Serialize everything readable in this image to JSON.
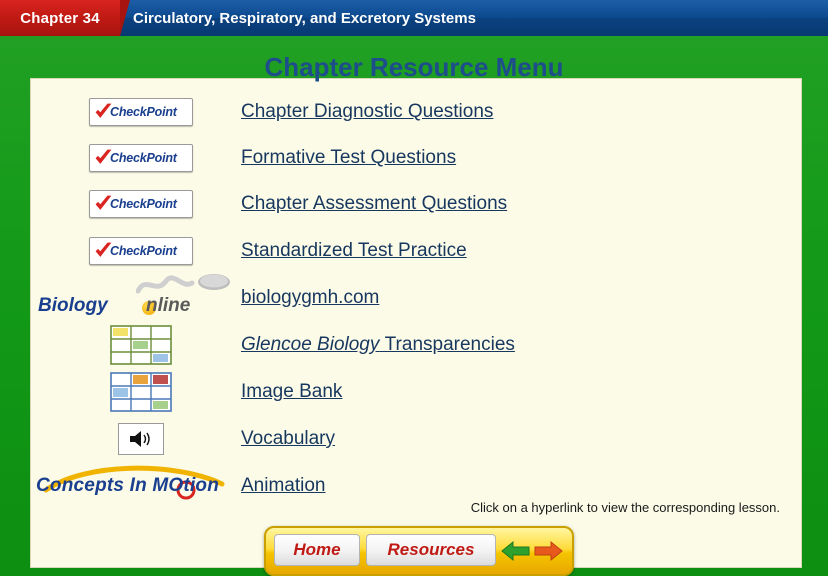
{
  "header": {
    "chapter_label": "Chapter 34",
    "title": "Circulatory, Respiratory, and Excretory Systems"
  },
  "slide": {
    "title": "Chapter Resource Menu",
    "footnote": "Click on a hyperlink to view the corresponding lesson.",
    "rows": [
      {
        "icon": "checkpoint-logo",
        "icon_text": "CheckPoint",
        "link": "Chapter Diagnostic Questions"
      },
      {
        "icon": "checkpoint-logo",
        "icon_text": "CheckPoint",
        "link": "Formative Test Questions"
      },
      {
        "icon": "checkpoint-logo",
        "icon_text": "CheckPoint",
        "link": "Chapter Assessment Questions"
      },
      {
        "icon": "checkpoint-logo",
        "icon_text": "CheckPoint",
        "link": "Standardized Test Practice"
      },
      {
        "icon": "biology-online-logo",
        "icon_text": "Biology Online",
        "link": "biologygmh.com"
      },
      {
        "icon": "transparency-grid-icon",
        "icon_text": "",
        "link": "Glencoe Biology Transparencies",
        "italic_words": "Glencoe Biology"
      },
      {
        "icon": "image-bank-grid-icon",
        "icon_text": "",
        "link": "Image Bank"
      },
      {
        "icon": "speaker-icon",
        "icon_text": "",
        "link": "Vocabulary"
      },
      {
        "icon": "concepts-in-motion-logo",
        "icon_text": "Concepts In MOtion",
        "link": "Animation"
      }
    ]
  },
  "nav": {
    "home_label": "Home",
    "resources_label": "Resources",
    "back_icon": "left-arrow-icon",
    "forward_icon": "right-arrow-icon"
  },
  "colors": {
    "header_blue": "#0d4a8f",
    "chapter_red": "#c01a14",
    "frame_green": "#14991a",
    "panel_cream": "#fbfbe8",
    "title_blue": "#1e4d8c",
    "link_blue": "#17375e",
    "nav_yellow": "#f5c400"
  }
}
